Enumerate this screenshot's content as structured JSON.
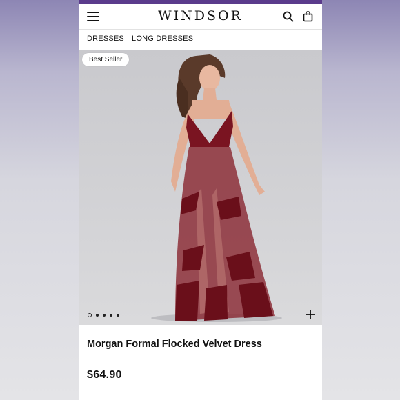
{
  "header": {
    "brand": "WINDSOR",
    "menu_icon": "hamburger-menu-icon",
    "search_icon": "search-icon",
    "bag_icon": "shopping-bag-icon"
  },
  "breadcrumb": {
    "items": [
      "DRESSES",
      "LONG DRESSES"
    ],
    "separator": "|"
  },
  "product": {
    "badge": "Best Seller",
    "title": "Morgan Formal Flocked Velvet Dress",
    "price": "$64.90",
    "image_count": 5,
    "active_image": 1,
    "add_icon": "plus-icon"
  },
  "colors": {
    "accent_strip": "#5b3b8c",
    "dress": "#7a1421"
  }
}
